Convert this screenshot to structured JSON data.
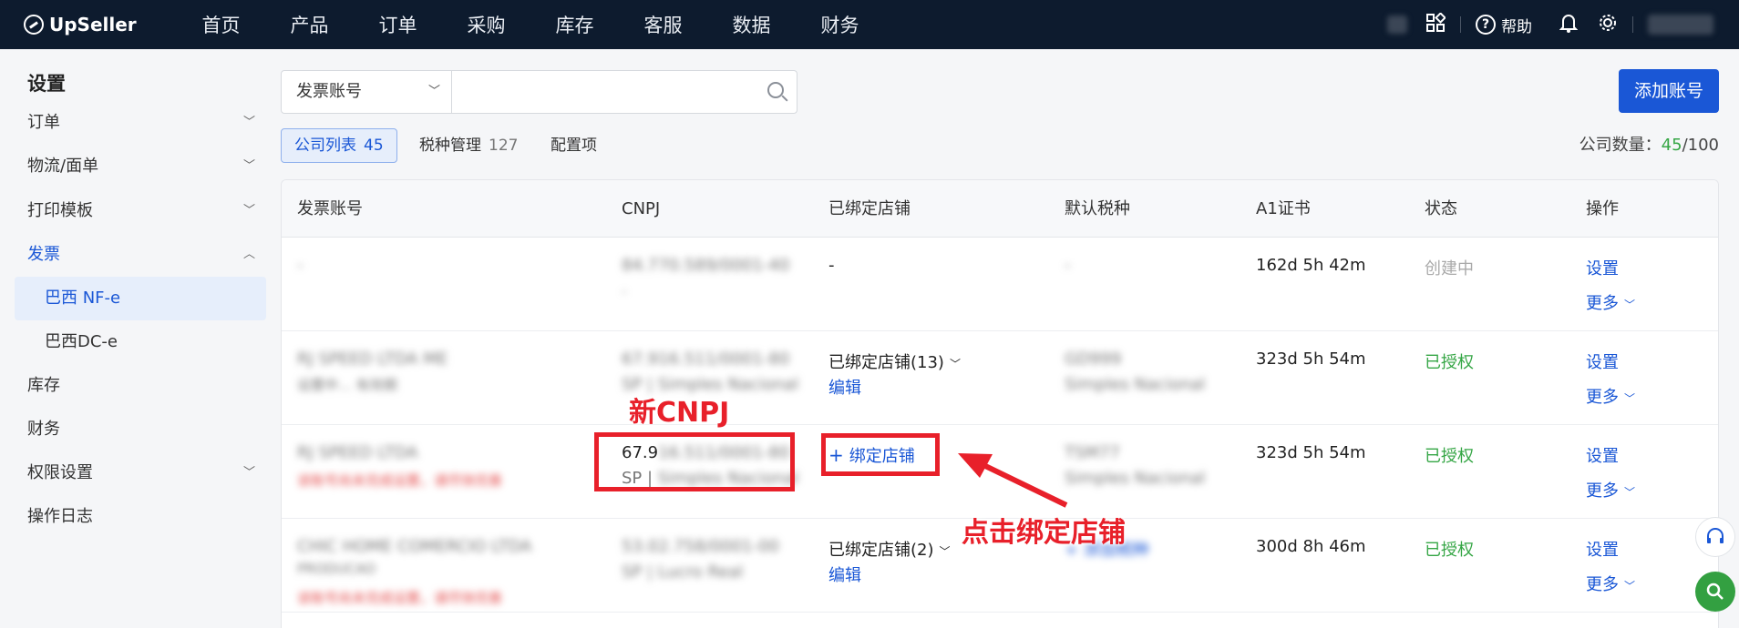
{
  "header": {
    "logo": "UpSeller",
    "nav": [
      "首页",
      "产品",
      "订单",
      "采购",
      "库存",
      "客服",
      "数据",
      "财务"
    ],
    "help_label": "帮助"
  },
  "sidebar": {
    "title": "设置",
    "items": [
      {
        "label": "订单",
        "chevron": "down"
      },
      {
        "label": "物流/面单",
        "chevron": "down"
      },
      {
        "label": "打印模板",
        "chevron": "down"
      },
      {
        "label": "发票",
        "chevron": "up"
      },
      {
        "label": "巴西 NF-e"
      },
      {
        "label": "巴西DC-e"
      },
      {
        "label": "库存"
      },
      {
        "label": "财务"
      },
      {
        "label": "权限设置",
        "chevron": "down"
      },
      {
        "label": "操作日志"
      }
    ]
  },
  "toolbar": {
    "select_value": "发票账号",
    "search_placeholder": "",
    "add_button": "添加账号"
  },
  "tabs": [
    {
      "label": "公司列表",
      "count": "45"
    },
    {
      "label": "税种管理",
      "count": "127"
    },
    {
      "label": "配置项",
      "count": ""
    }
  ],
  "company_count": {
    "label": "公司数量：",
    "current": "45",
    "total": "/100"
  },
  "table": {
    "columns": [
      "发票账号",
      "CNPJ",
      "已绑定店铺",
      "默认税种",
      "A1证书",
      "状态",
      "操作"
    ],
    "rows": [
      {
        "account": "-",
        "cnpj": "84.770.589/0001-40",
        "cnpj_sub": "-",
        "stores": "-",
        "tax": "-",
        "cert": "162d 5h 42m",
        "status": "创建中",
        "action": "设置",
        "more": "更多"
      },
      {
        "account": "RJ SPEED LTDA ME",
        "account_sub": "设置中…  有效期",
        "cnpj": "67.916.511/0001-80",
        "cnpj_sub": "SP | Simples Nacional",
        "stores": "已绑定店铺(13)",
        "edit": "编辑",
        "tax": "GD999",
        "tax_sub": "Simples Nacional",
        "cert": "323d 5h 54m",
        "status": "已授权",
        "action": "设置",
        "more": "更多"
      },
      {
        "account": "RJ SPEED LTDA",
        "account_warn": "该账号尚未完成设置，请尽快完善",
        "cnpj": "67.9",
        "cnpj_hidden": "16.511/0001-80",
        "cnpj_sub": "SP | ",
        "cnpj_sub_hidden": "Simples Nacional",
        "bind": "绑定店铺",
        "tax": "TSM77",
        "tax_sub": "Simples Nacional",
        "cert": "323d 5h 54m",
        "status": "已授权",
        "action": "设置",
        "more": "更多"
      },
      {
        "account": "CHIC HOME COMERCIO LTDA",
        "account_sub": "PRODUCAO",
        "account_warn": "该账号尚未完成设置，请尽快完善",
        "cnpj": "53.0",
        "cnpj_hidden": "2.758/0001-00",
        "cnpj_sub": "SP | Lucro Real",
        "stores": "已绑定店铺(2)",
        "edit": "编辑",
        "tax": "+ 添加税种",
        "cert": "300d 8h 46m",
        "status": "已授权",
        "action": "设置",
        "more": "更多"
      }
    ]
  },
  "annotations": {
    "new_cnpj": "新CNPJ",
    "click_bind": "点击绑定店铺"
  },
  "colors": {
    "primary": "#1a57d6",
    "topbar": "#0d1b2e",
    "success": "#35a645",
    "annotation": "#e8202a"
  }
}
